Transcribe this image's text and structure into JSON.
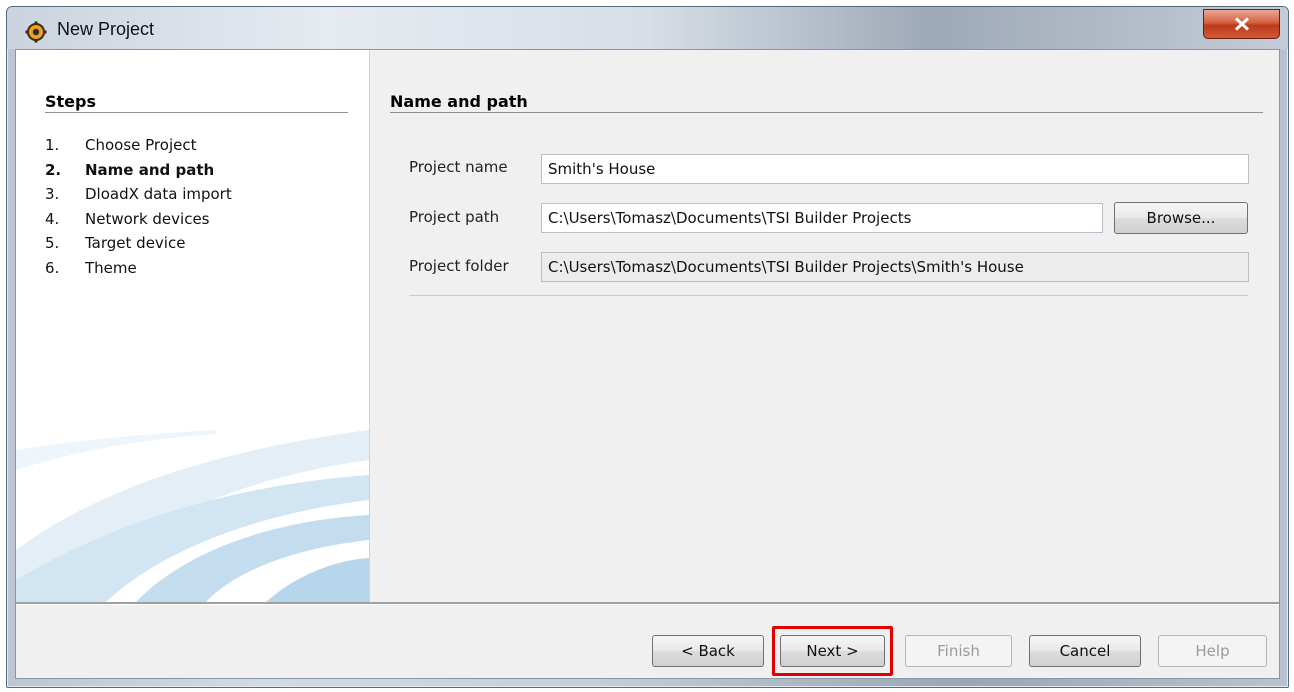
{
  "window": {
    "title": "New Project"
  },
  "steps": {
    "heading": "Steps",
    "items": [
      {
        "num": "1.",
        "label": "Choose Project"
      },
      {
        "num": "2.",
        "label": "Name and path"
      },
      {
        "num": "3.",
        "label": "DloadX data import"
      },
      {
        "num": "4.",
        "label": "Network devices"
      },
      {
        "num": "5.",
        "label": "Target device"
      },
      {
        "num": "6.",
        "label": "Theme"
      }
    ],
    "active_index": 1
  },
  "section": {
    "heading": "Name and path"
  },
  "form": {
    "project_name_label": "Project name",
    "project_name_value": "Smith's House",
    "project_path_label": "Project path",
    "project_path_value": "C:\\Users\\Tomasz\\Documents\\TSI Builder Projects",
    "browse_label": "Browse...",
    "project_folder_label": "Project folder",
    "project_folder_value": "C:\\Users\\Tomasz\\Documents\\TSI Builder Projects\\Smith's House"
  },
  "buttons": {
    "back": "< Back",
    "next": "Next >",
    "finish": "Finish",
    "cancel": "Cancel",
    "help": "Help"
  },
  "colors": {
    "highlight": "#e00000",
    "close_button": "#c94a28"
  }
}
